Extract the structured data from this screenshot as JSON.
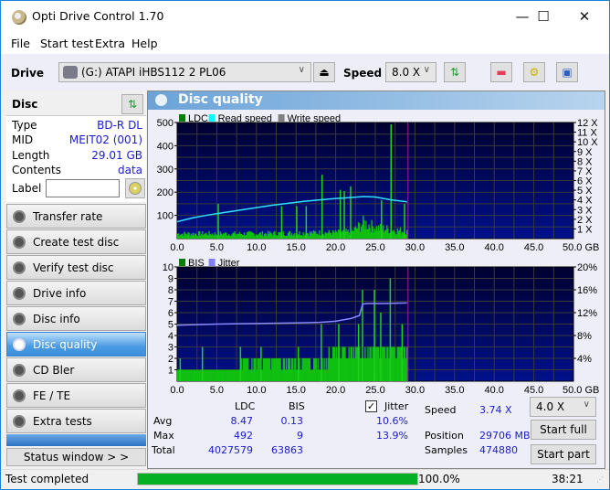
{
  "window": {
    "title": "Opti Drive Control 1.70",
    "minimize_icon": "minimize-icon",
    "maximize_icon": "maximize-icon",
    "close_icon": "close-icon"
  },
  "menu": [
    "File",
    "Start test",
    "Extra",
    "Help"
  ],
  "toolbar": {
    "drive_label": "Drive",
    "drive_value": "(G:)  ATAPI iHBS112  2 PL06",
    "speed_label": "Speed",
    "speed_value": "8.0 X",
    "icons": [
      "eject-icon",
      "refresh-icon",
      "eraser-icon",
      "settings-icon",
      "save-icon"
    ]
  },
  "disc": {
    "header": "Disc",
    "rows": [
      {
        "key": "Type",
        "value": "BD-R DL"
      },
      {
        "key": "MID",
        "value": "MEIT02 (001)"
      },
      {
        "key": "Length",
        "value": "29.01 GB"
      },
      {
        "key": "Contents",
        "value": "data"
      }
    ],
    "label_key": "Label",
    "label_value": ""
  },
  "nav": [
    {
      "label": "Transfer rate",
      "active": false
    },
    {
      "label": "Create test disc",
      "active": false
    },
    {
      "label": "Verify test disc",
      "active": false
    },
    {
      "label": "Drive info",
      "active": false
    },
    {
      "label": "Disc info",
      "active": false
    },
    {
      "label": "Disc quality",
      "active": true
    },
    {
      "label": "CD Bler",
      "active": false
    },
    {
      "label": "FE / TE",
      "active": false
    },
    {
      "label": "Extra tests",
      "active": false
    }
  ],
  "status_window_label": "Status window > >",
  "panel_title": "Disc quality",
  "chart_data": [
    {
      "type": "bar",
      "title": "LDC / Read speed",
      "legend": [
        {
          "name": "LDC",
          "color": "#008000"
        },
        {
          "name": "Read speed",
          "color": "#00ffff"
        },
        {
          "name": "Write speed",
          "color": "#808080"
        }
      ],
      "xlabel": "GB",
      "xlim": [
        0,
        50
      ],
      "x_ticks": [
        "0.0",
        "5.0",
        "10.0",
        "15.0",
        "20.0",
        "25.0",
        "30.0",
        "35.0",
        "40.0",
        "45.0",
        "50.0 GB"
      ],
      "ylim_left": [
        0,
        500
      ],
      "y_ticks_left": [
        "100",
        "200",
        "300",
        "400",
        "500"
      ],
      "ylim_right": [
        0,
        12
      ],
      "y_ticks_right": [
        "1 X",
        "2 X",
        "3 X",
        "4 X",
        "5 X",
        "6 X",
        "7 X",
        "8 X",
        "9 X",
        "10 X",
        "11 X",
        "12 X"
      ],
      "data_end_gb": 29.01,
      "read_speed_x": {
        "x": [
          0,
          2,
          4,
          6,
          8,
          10,
          12,
          14,
          16,
          18,
          20,
          22,
          23.5,
          25,
          27,
          29
        ],
        "values": [
          1.75,
          2.15,
          2.45,
          2.7,
          2.95,
          3.2,
          3.45,
          3.65,
          3.85,
          4.0,
          4.15,
          4.25,
          4.35,
          4.3,
          4.0,
          3.8
        ]
      },
      "ldc_baseline": {
        "x": [
          0,
          5,
          10,
          15,
          18,
          20,
          22,
          23.5,
          25,
          27,
          29
        ],
        "values": [
          25,
          25,
          25,
          28,
          30,
          30,
          35,
          80,
          55,
          45,
          35
        ]
      },
      "ldc_spikes": [
        {
          "x": 5.1,
          "value": 150
        },
        {
          "x": 13.1,
          "value": 140
        },
        {
          "x": 15.0,
          "value": 140
        },
        {
          "x": 16.2,
          "value": 140
        },
        {
          "x": 18.2,
          "value": 275
        },
        {
          "x": 20.5,
          "value": 210
        },
        {
          "x": 21.0,
          "value": 205
        },
        {
          "x": 21.8,
          "value": 225
        },
        {
          "x": 25.7,
          "value": 165
        },
        {
          "x": 26.9,
          "value": 492
        },
        {
          "x": 28.6,
          "value": 150
        }
      ]
    },
    {
      "type": "bar",
      "title": "BIS / Jitter",
      "legend": [
        {
          "name": "BIS",
          "color": "#008000"
        },
        {
          "name": "Jitter",
          "color": "#8080ff"
        }
      ],
      "xlabel": "GB",
      "xlim": [
        0,
        50
      ],
      "x_ticks": [
        "0.0",
        "5.0",
        "10.0",
        "15.0",
        "20.0",
        "25.0",
        "30.0",
        "35.0",
        "40.0",
        "45.0",
        "50.0 GB"
      ],
      "ylim_left": [
        0,
        10
      ],
      "y_ticks_left": [
        "1",
        "2",
        "3",
        "4",
        "5",
        "6",
        "7",
        "8",
        "9",
        "10"
      ],
      "ylim_right": [
        0,
        20
      ],
      "y_ticks_right": [
        "4%",
        "8%",
        "12%",
        "16%",
        "20%"
      ],
      "data_end_gb": 29.01,
      "jitter_pct": {
        "x": [
          0,
          5,
          10,
          15,
          18,
          20,
          22,
          23,
          23.4,
          24,
          26,
          29
        ],
        "values": [
          9.8,
          10.0,
          10.1,
          10.2,
          10.3,
          10.5,
          11.0,
          11.5,
          13.5,
          13.6,
          13.6,
          13.7
        ]
      },
      "bis_baseline": {
        "x": [
          0,
          16,
          22,
          23,
          29
        ],
        "values": [
          1,
          2,
          3,
          3,
          3
        ]
      },
      "bis_spikes": [
        {
          "x": 0.3,
          "value": 2
        },
        {
          "x": 3.1,
          "value": 3
        },
        {
          "x": 7.9,
          "value": 3
        },
        {
          "x": 10.5,
          "value": 3
        },
        {
          "x": 15.2,
          "value": 3
        },
        {
          "x": 18.1,
          "value": 5
        },
        {
          "x": 20.3,
          "value": 5
        },
        {
          "x": 22.8,
          "value": 5
        },
        {
          "x": 23.3,
          "value": 8
        },
        {
          "x": 24.8,
          "value": 8
        },
        {
          "x": 26.8,
          "value": 9
        },
        {
          "x": 25.6,
          "value": 6
        },
        {
          "x": 28.3,
          "value": 5
        }
      ]
    }
  ],
  "stats": {
    "col_ldc": "LDC",
    "col_bis": "BIS",
    "jitter_label": "Jitter",
    "jitter_checked": true,
    "rows": [
      {
        "label": "Avg",
        "ldc": "8.47",
        "bis": "0.13",
        "jitter": "10.6%"
      },
      {
        "label": "Max",
        "ldc": "492",
        "bis": "9",
        "jitter": "13.9%"
      },
      {
        "label": "Total",
        "ldc": "4027579",
        "bis": "63863",
        "jitter": ""
      }
    ],
    "speed_label": "Speed",
    "speed_value": "3.74 X",
    "position_label": "Position",
    "position_value": "29706 MB",
    "samples_label": "Samples",
    "samples_value": "474880",
    "speed_select": "4.0 X",
    "start_full": "Start full",
    "start_part": "Start part"
  },
  "statusbar": {
    "message": "Test completed",
    "progress_pct": 100.0,
    "progress_text": "100.0%",
    "elapsed": "38:21"
  }
}
